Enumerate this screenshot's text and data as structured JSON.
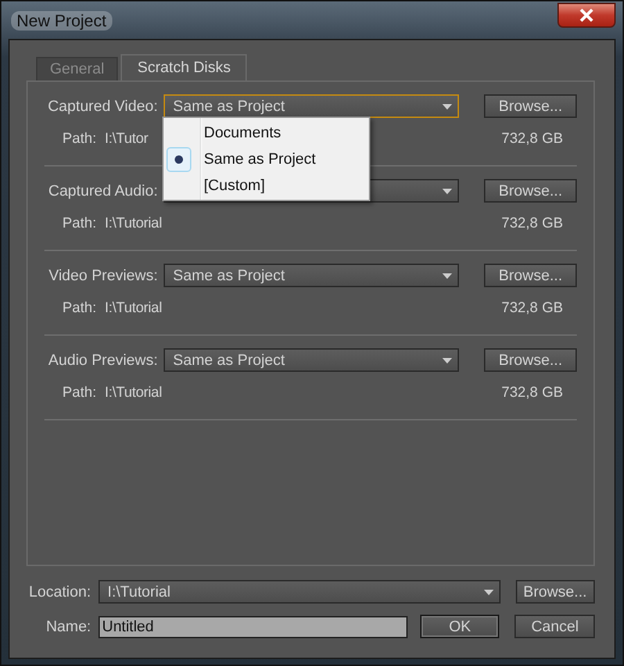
{
  "window": {
    "title": "New Project"
  },
  "tabs": [
    {
      "label": "General",
      "selected": false
    },
    {
      "label": "Scratch Disks",
      "selected": true
    }
  ],
  "sections": [
    {
      "label": "Captured Video:",
      "value": "Same as Project",
      "focused": true,
      "path_label": "Path:",
      "path": "I:\\Tutor",
      "size": "732,8 GB",
      "browse": "Browse..."
    },
    {
      "label": "Captured Audio:",
      "focused": false,
      "path_label": "Path:",
      "path": "I:\\Tutorial",
      "size": "732,8 GB",
      "browse": "Browse..."
    },
    {
      "label": "Video Previews:",
      "value": "Same as Project",
      "focused": false,
      "path_label": "Path:",
      "path": "I:\\Tutorial",
      "size": "732,8 GB",
      "browse": "Browse..."
    },
    {
      "label": "Audio Previews:",
      "value": "Same as Project",
      "focused": false,
      "path_label": "Path:",
      "path": "I:\\Tutorial",
      "size": "732,8 GB",
      "browse": "Browse..."
    }
  ],
  "dropdown_menu": {
    "items": [
      {
        "label": "Documents",
        "selected": false
      },
      {
        "label": "Same as Project",
        "selected": true
      },
      {
        "label": "[Custom]",
        "selected": false
      }
    ]
  },
  "location": {
    "label": "Location:",
    "value": "I:\\Tutorial",
    "browse": "Browse..."
  },
  "name": {
    "label": "Name:",
    "value": "Untitled"
  },
  "buttons": [
    "OK",
    "Cancel"
  ]
}
